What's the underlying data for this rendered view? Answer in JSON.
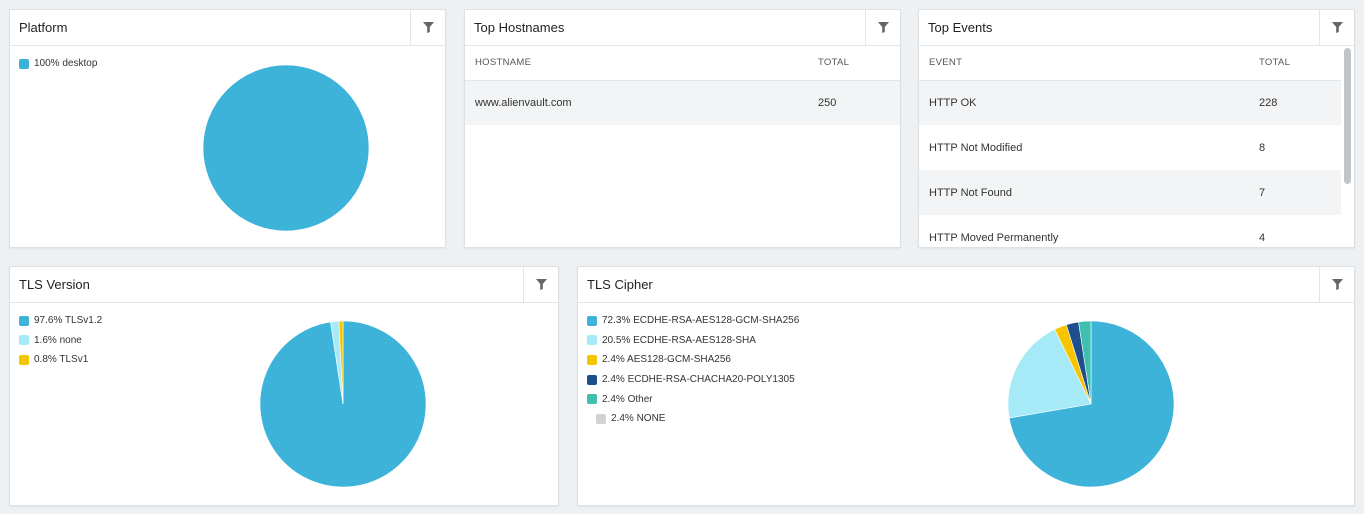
{
  "platform": {
    "title": "Platform",
    "legend": [
      {
        "label": "100% desktop",
        "color": "#3eb3d9"
      }
    ],
    "chart_data": {
      "type": "pie",
      "categories": [
        "desktop"
      ],
      "values": [
        100
      ],
      "colors": [
        "#3eb3d9"
      ]
    }
  },
  "hostnames": {
    "title": "Top Hostnames",
    "columns": [
      "HOSTNAME",
      "TOTAL"
    ],
    "rows": [
      {
        "name": "www.alienvault.com",
        "total": "250"
      }
    ]
  },
  "events": {
    "title": "Top Events",
    "columns": [
      "EVENT",
      "TOTAL"
    ],
    "rows": [
      {
        "name": "HTTP OK",
        "total": "228"
      },
      {
        "name": "HTTP Not Modified",
        "total": "8"
      },
      {
        "name": "HTTP Not Found",
        "total": "7"
      },
      {
        "name": "HTTP Moved Permanently",
        "total": "4"
      }
    ]
  },
  "tls_version": {
    "title": "TLS Version",
    "legend": [
      {
        "label": "97.6% TLSv1.2",
        "color": "#3eb3d9"
      },
      {
        "label": "1.6% none",
        "color": "#a6e9f7"
      },
      {
        "label": "0.8% TLSv1",
        "color": "#f6c500"
      }
    ],
    "chart_data": {
      "type": "pie",
      "categories": [
        "TLSv1.2",
        "none",
        "TLSv1"
      ],
      "values": [
        97.6,
        1.6,
        0.8
      ],
      "colors": [
        "#3eb3d9",
        "#a6e9f7",
        "#f6c500"
      ]
    }
  },
  "tls_cipher": {
    "title": "TLS Cipher",
    "legend": [
      {
        "label": "72.3% ECDHE-RSA-AES128-GCM-SHA256",
        "color": "#3eb3d9"
      },
      {
        "label": "20.5% ECDHE-RSA-AES128-SHA",
        "color": "#a6e9f7"
      },
      {
        "label": "2.4% AES128-GCM-SHA256",
        "color": "#f6c500"
      },
      {
        "label": "2.4% ECDHE-RSA-CHACHA20-POLY1305",
        "color": "#1f4e8c"
      },
      {
        "label": "2.4% Other",
        "color": "#3fbfae"
      },
      {
        "label": "2.4% NONE",
        "color": "#d3d3d3"
      }
    ],
    "chart_data": {
      "type": "pie",
      "categories": [
        "ECDHE-RSA-AES128-GCM-SHA256",
        "ECDHE-RSA-AES128-SHA",
        "AES128-GCM-SHA256",
        "ECDHE-RSA-CHACHA20-POLY1305",
        "Other",
        "NONE"
      ],
      "values": [
        72.3,
        20.5,
        2.4,
        2.4,
        2.4,
        0.0
      ],
      "colors": [
        "#3eb3d9",
        "#a6e9f7",
        "#f6c500",
        "#1f4e8c",
        "#3fbfae",
        "#d3d3d3"
      ]
    }
  }
}
